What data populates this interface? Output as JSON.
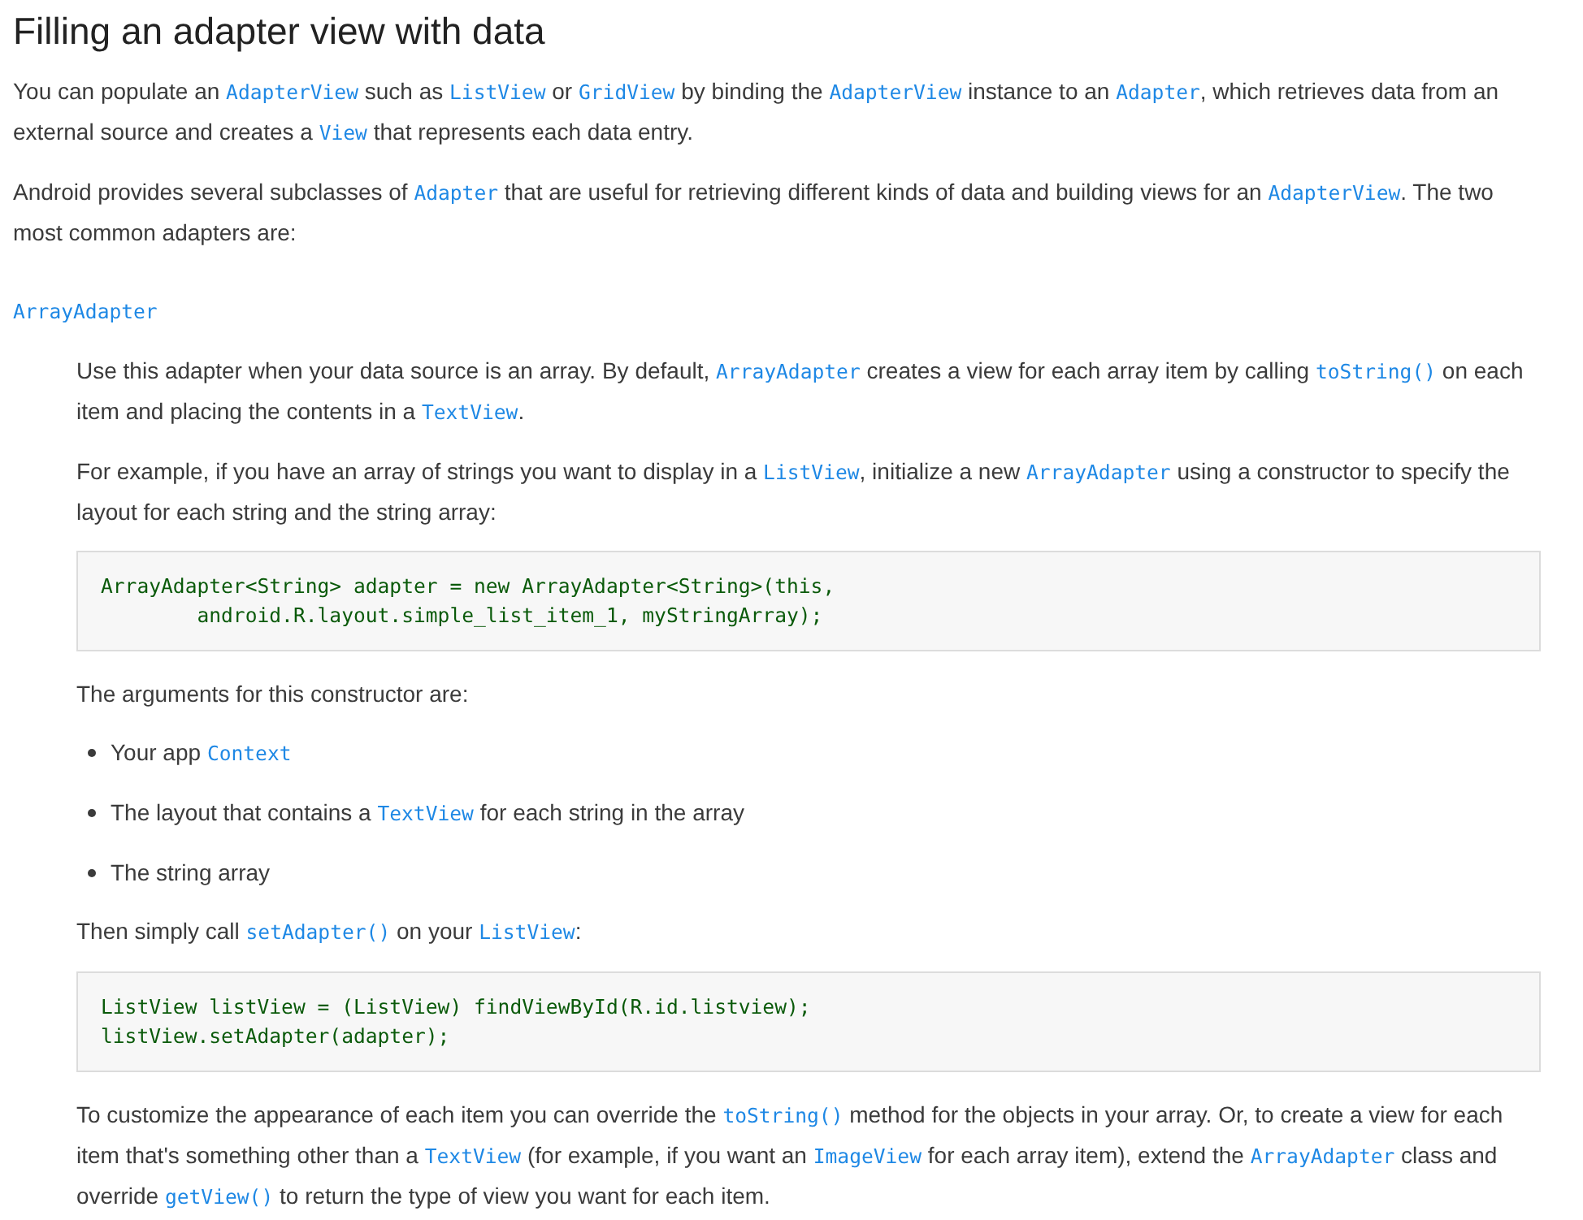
{
  "title": "Filling an adapter view with data",
  "intro": [
    [
      {
        "kind": "text",
        "t": "You can populate an "
      },
      {
        "kind": "code",
        "t": "AdapterView"
      },
      {
        "kind": "text",
        "t": " such as "
      },
      {
        "kind": "code",
        "t": "ListView"
      },
      {
        "kind": "text",
        "t": " or "
      },
      {
        "kind": "code",
        "t": "GridView"
      },
      {
        "kind": "text",
        "t": " by binding the "
      },
      {
        "kind": "code",
        "t": "AdapterView"
      },
      {
        "kind": "text",
        "t": " instance to an "
      },
      {
        "kind": "code",
        "t": "Adapter"
      },
      {
        "kind": "text",
        "t": ", which retrieves data from an external source and creates a "
      },
      {
        "kind": "code",
        "t": "View"
      },
      {
        "kind": "text",
        "t": " that represents each data entry."
      }
    ],
    [
      {
        "kind": "text",
        "t": "Android provides several subclasses of "
      },
      {
        "kind": "code",
        "t": "Adapter"
      },
      {
        "kind": "text",
        "t": " that are useful for retrieving different kinds of data and building views for an "
      },
      {
        "kind": "code",
        "t": "AdapterView"
      },
      {
        "kind": "text",
        "t": ". The two most common adapters are:"
      }
    ]
  ],
  "term": "ArrayAdapter",
  "blocks": [
    {
      "kind": "paragraph",
      "segments": [
        {
          "kind": "text",
          "t": "Use this adapter when your data source is an array. By default, "
        },
        {
          "kind": "code",
          "t": "ArrayAdapter"
        },
        {
          "kind": "text",
          "t": " creates a view for each array item by calling "
        },
        {
          "kind": "code",
          "t": "toString()"
        },
        {
          "kind": "text",
          "t": " on each item and placing the contents in a "
        },
        {
          "kind": "code",
          "t": "TextView"
        },
        {
          "kind": "text",
          "t": "."
        }
      ]
    },
    {
      "kind": "paragraph",
      "segments": [
        {
          "kind": "text",
          "t": "For example, if you have an array of strings you want to display in a "
        },
        {
          "kind": "code",
          "t": "ListView"
        },
        {
          "kind": "text",
          "t": ", initialize a new "
        },
        {
          "kind": "code",
          "t": "ArrayAdapter"
        },
        {
          "kind": "text",
          "t": " using a constructor to specify the layout for each string and the string array:"
        }
      ]
    },
    {
      "kind": "code_block",
      "lines": [
        "ArrayAdapter<String> adapter = new ArrayAdapter<String>(this,",
        "        android.R.layout.simple_list_item_1, myStringArray);"
      ]
    },
    {
      "kind": "paragraph",
      "segments": [
        {
          "kind": "text",
          "t": "The arguments for this constructor are:"
        }
      ]
    },
    {
      "kind": "bullets",
      "items": [
        [
          {
            "kind": "text",
            "t": "Your app "
          },
          {
            "kind": "code",
            "t": "Context"
          }
        ],
        [
          {
            "kind": "text",
            "t": "The layout that contains a "
          },
          {
            "kind": "code",
            "t": "TextView"
          },
          {
            "kind": "text",
            "t": " for each string in the array"
          }
        ],
        [
          {
            "kind": "text",
            "t": "The string array"
          }
        ]
      ]
    },
    {
      "kind": "paragraph",
      "segments": [
        {
          "kind": "text",
          "t": "Then simply call "
        },
        {
          "kind": "code",
          "t": "setAdapter()"
        },
        {
          "kind": "text",
          "t": " on your "
        },
        {
          "kind": "code",
          "t": "ListView"
        },
        {
          "kind": "text",
          "t": ":"
        }
      ]
    },
    {
      "kind": "code_block",
      "lines": [
        "ListView listView = (ListView) findViewById(R.id.listview);",
        "listView.setAdapter(adapter);"
      ]
    },
    {
      "kind": "paragraph",
      "segments": [
        {
          "kind": "text",
          "t": "To customize the appearance of each item you can override the "
        },
        {
          "kind": "code",
          "t": "toString()"
        },
        {
          "kind": "text",
          "t": " method for the objects in your array. Or, to create a view for each item that's something other than a "
        },
        {
          "kind": "code",
          "t": "TextView"
        },
        {
          "kind": "text",
          "t": " (for example, if you want an "
        },
        {
          "kind": "code",
          "t": "ImageView"
        },
        {
          "kind": "text",
          "t": " for each array item), extend the "
        },
        {
          "kind": "code",
          "t": "ArrayAdapter"
        },
        {
          "kind": "text",
          "t": " class and override "
        },
        {
          "kind": "code",
          "t": "getView()"
        },
        {
          "kind": "text",
          "t": " to return the type of view you want for each item."
        }
      ]
    }
  ]
}
